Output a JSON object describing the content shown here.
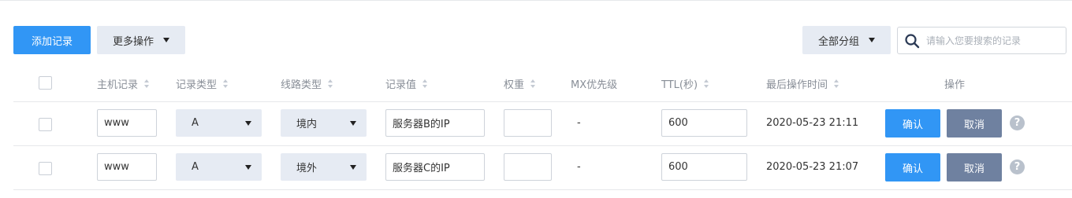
{
  "toolbar": {
    "add_label": "添加记录",
    "more_label": "更多操作",
    "group_label": "全部分组",
    "search_placeholder": "请输入您要搜索的记录"
  },
  "table": {
    "headers": {
      "host": "主机记录",
      "type": "记录类型",
      "line": "线路类型",
      "value": "记录值",
      "weight": "权重",
      "mx": "MX优先级",
      "ttl": "TTL(秒)",
      "updated": "最后操作时间",
      "actions": "操作"
    },
    "rows": [
      {
        "host": "www",
        "type": "A",
        "line": "境内",
        "value": "服务器B的IP",
        "weight": "",
        "mx": "-",
        "ttl": "600",
        "updated": "2020-05-23 21:11",
        "confirm": "确认",
        "cancel": "取消"
      },
      {
        "host": "www",
        "type": "A",
        "line": "境外",
        "value": "服务器C的IP",
        "weight": "",
        "mx": "-",
        "ttl": "600",
        "updated": "2020-05-23 21:07",
        "confirm": "确认",
        "cancel": "取消"
      }
    ]
  },
  "colors": {
    "primary": "#3196f5",
    "cancel": "#6f81a0",
    "select_bg": "#e6ebf3"
  }
}
